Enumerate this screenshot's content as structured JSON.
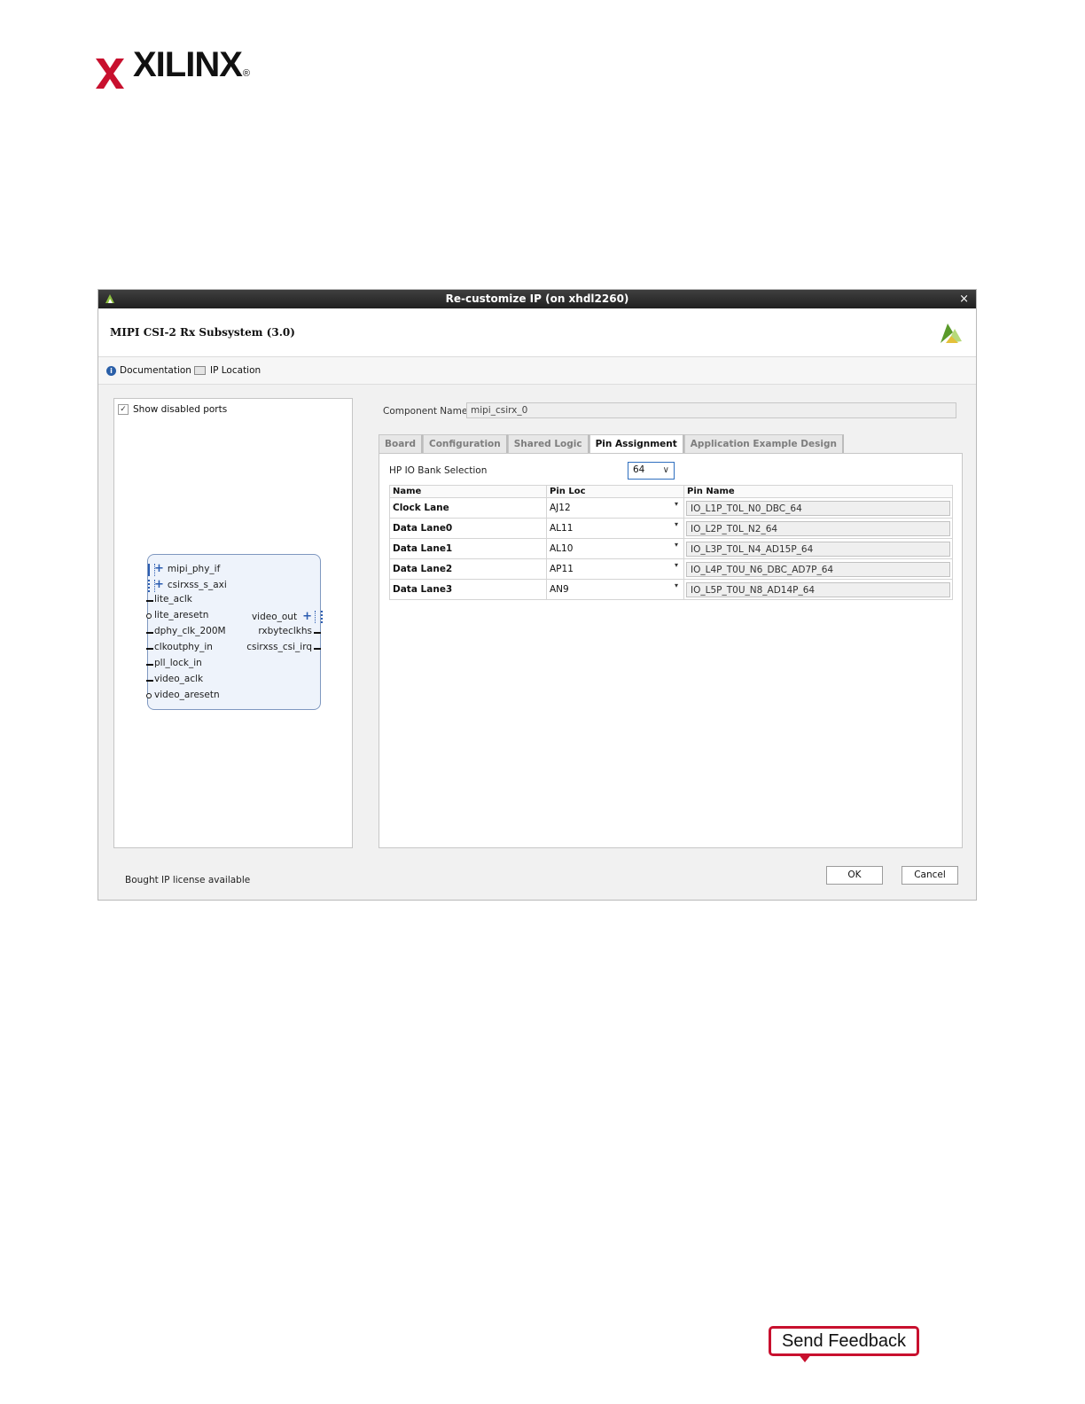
{
  "page": {
    "logo_text": "XILINX",
    "logo_reg": "®",
    "feedback_label": "Send Feedback"
  },
  "dialog": {
    "window_title": "Re-customize IP (on xhdl2260)",
    "close_glyph": "×",
    "ip_name": "MIPI CSI-2 Rx Subsystem (3.0)",
    "links": {
      "documentation": "Documentation",
      "ip_location": "IP Location"
    },
    "show_disabled_ports": {
      "label": "Show disabled ports",
      "checked": true,
      "check_glyph": "✓"
    },
    "component_name": {
      "label": "Component Name",
      "value": "mipi_csirx_0"
    },
    "tabs": [
      {
        "label": "Board",
        "active": false
      },
      {
        "label": "Configuration",
        "active": false
      },
      {
        "label": "Shared Logic",
        "active": false
      },
      {
        "label": "Pin Assignment",
        "active": true
      },
      {
        "label": "Application Example Design",
        "active": false
      }
    ],
    "hp_io_bank": {
      "label": "HP IO Bank Selection",
      "value": "64",
      "chevron": "∨"
    },
    "pin_table": {
      "headers": [
        "Name",
        "Pin Loc",
        "Pin Name"
      ],
      "dropdown_glyph": "▾",
      "rows": [
        {
          "name": "Clock Lane",
          "pin_loc": "AJ12",
          "pin_name": "IO_L1P_T0L_N0_DBC_64"
        },
        {
          "name": "Data Lane0",
          "pin_loc": "AL11",
          "pin_name": "IO_L2P_T0L_N2_64"
        },
        {
          "name": "Data Lane1",
          "pin_loc": "AL10",
          "pin_name": "IO_L3P_T0L_N4_AD15P_64"
        },
        {
          "name": "Data Lane2",
          "pin_loc": "AP11",
          "pin_name": "IO_L4P_T0U_N6_DBC_AD7P_64"
        },
        {
          "name": "Data Lane3",
          "pin_loc": "AN9",
          "pin_name": "IO_L5P_T0U_N8_AD14P_64"
        }
      ]
    },
    "symbol": {
      "plus_glyph": "+",
      "inputs": [
        "mipi_phy_if",
        "csirxss_s_axi",
        "lite_aclk",
        "lite_aresetn",
        "dphy_clk_200M",
        "clkoutphy_in",
        "pll_lock_in",
        "video_aclk",
        "video_aresetn"
      ],
      "outputs": [
        "video_out",
        "rxbyteclkhs",
        "csirxss_csi_irq"
      ]
    },
    "license_text": "Bought IP license available",
    "ok_label": "OK",
    "cancel_label": "Cancel"
  },
  "colors": {
    "brand_red": "#c8102e",
    "titlebar": "#2a2a2a",
    "focus_blue": "#2f6fbf",
    "symbol_fill": "#eef3fb"
  },
  "icons": [
    "xilinx-logo-icon",
    "vivado-icon",
    "info-icon",
    "folder-icon",
    "close-icon",
    "chevron-down-icon",
    "plus-icon"
  ]
}
